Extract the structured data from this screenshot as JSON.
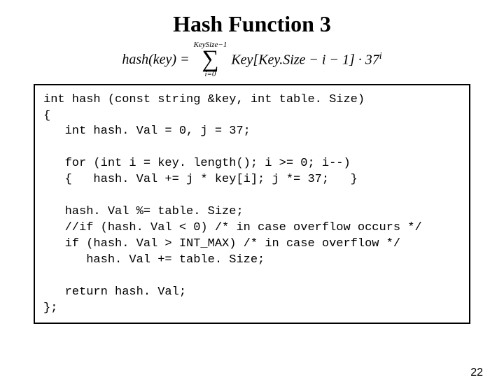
{
  "title": "Hash Function 3",
  "formula": {
    "lhs": "hash(key) =",
    "sigma_top": "KeySize−1",
    "sigma_bot": "i=0",
    "rhs_a": "Key[Key.Size − i − 1] · 37",
    "rhs_exp": "i"
  },
  "code": {
    "l1": "int hash (const string &key, int table. Size)",
    "l2": "{",
    "l3": "   int hash. Val = 0, j = 37;",
    "blank1": "",
    "l4": "   for (int i = key. length(); i >= 0; i--)",
    "l5": "   {   hash. Val += j * key[i]; j *= 37;   }",
    "blank2": "",
    "l6": "   hash. Val %= table. Size;",
    "l7": "   //if (hash. Val < 0) /* in case overflow occurs */",
    "l8": "   if (hash. Val > INT_MAX) /* in case overflow */",
    "l9": "      hash. Val += table. Size;",
    "blank3": "",
    "l10": "   return hash. Val;",
    "l11": "};"
  },
  "page_number": "22"
}
